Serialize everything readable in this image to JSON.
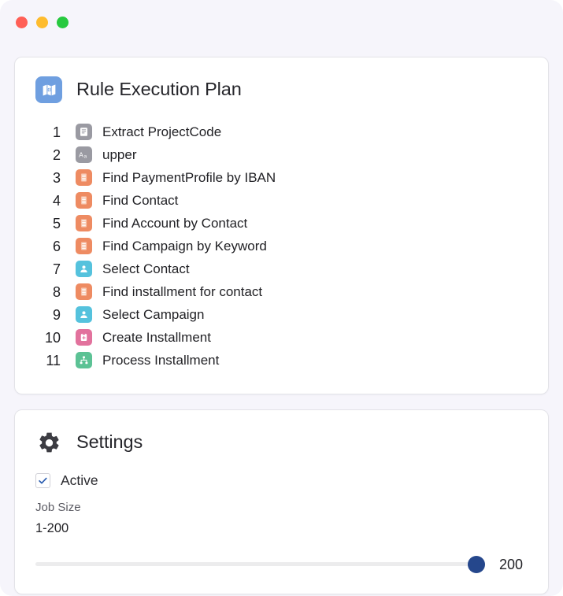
{
  "window": {
    "traffic_lights": [
      {
        "name": "close-button",
        "color": "#ff5f56"
      },
      {
        "name": "minimize-button",
        "color": "#febc2e"
      },
      {
        "name": "maximize-button",
        "color": "#27c93f"
      }
    ]
  },
  "plan_card": {
    "icon": "map-plan-icon",
    "icon_color": "#6f9fe0",
    "title": "Rule Execution Plan",
    "steps": [
      {
        "number": "1",
        "icon": "document-icon",
        "icon_color": "#9a9aa2",
        "label": "Extract ProjectCode"
      },
      {
        "number": "2",
        "icon": "text-case-icon",
        "icon_color": "#9a9aa2",
        "label": "upper"
      },
      {
        "number": "3",
        "icon": "database-icon",
        "icon_color": "#ee8b62",
        "label": "Find PaymentProfile by IBAN"
      },
      {
        "number": "4",
        "icon": "database-icon",
        "icon_color": "#ee8b62",
        "label": "Find Contact"
      },
      {
        "number": "5",
        "icon": "database-icon",
        "icon_color": "#ee8b62",
        "label": "Find Account by Contact"
      },
      {
        "number": "6",
        "icon": "database-icon",
        "icon_color": "#ee8b62",
        "label": "Find Campaign by Keyword"
      },
      {
        "number": "7",
        "icon": "person-icon",
        "icon_color": "#55c2dd",
        "label": "Select Contact"
      },
      {
        "number": "8",
        "icon": "database-icon",
        "icon_color": "#ee8b62",
        "label": "Find installment for contact"
      },
      {
        "number": "9",
        "icon": "person-icon",
        "icon_color": "#55c2dd",
        "label": "Select Campaign"
      },
      {
        "number": "10",
        "icon": "clipboard-icon",
        "icon_color": "#e2729d",
        "label": "Create Installment"
      },
      {
        "number": "11",
        "icon": "process-flow-icon",
        "icon_color": "#5cc295",
        "label": "Process Installment"
      }
    ]
  },
  "settings_card": {
    "icon": "gear-icon",
    "title": "Settings",
    "active": {
      "label": "Active",
      "checked": true,
      "check_color": "#2a5db0"
    },
    "job_size": {
      "label": "Job Size",
      "range": "1-200",
      "value": "200",
      "slider_percent": 100,
      "thumb_color": "#25478c",
      "track_color": "#ececed"
    }
  }
}
